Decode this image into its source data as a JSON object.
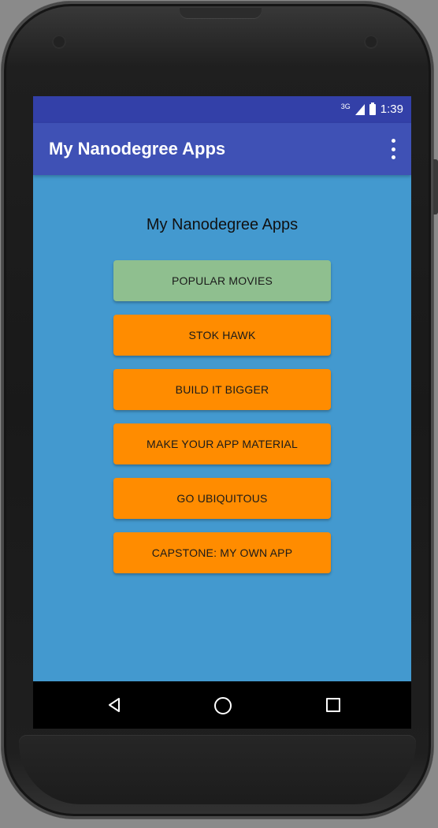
{
  "status_bar": {
    "network": "3G",
    "time": "1:39"
  },
  "app_bar": {
    "title": "My Nanodegree Apps",
    "overflow_icon": "more-vert-icon"
  },
  "main": {
    "heading": "My Nanodegree Apps",
    "buttons": [
      {
        "label": "POPULAR MOVIES",
        "color": "#8fbf8f"
      },
      {
        "label": "STOK HAWK",
        "color": "#ff8c00"
      },
      {
        "label": "BUILD IT BIGGER",
        "color": "#ff8c00"
      },
      {
        "label": "MAKE YOUR APP MATERIAL",
        "color": "#ff8c00"
      },
      {
        "label": "GO UBIQUITOUS",
        "color": "#ff8c00"
      },
      {
        "label": "CAPSTONE: MY OWN APP",
        "color": "#ff8c00"
      }
    ]
  },
  "nav_bar": {
    "icons": [
      "back-icon",
      "home-icon",
      "recent-apps-icon"
    ]
  },
  "colors": {
    "status_bar": "#3340a8",
    "app_bar": "#3f51b5",
    "background": "#4399cf",
    "accent": "#ff8c00",
    "highlight": "#8fbf8f"
  }
}
